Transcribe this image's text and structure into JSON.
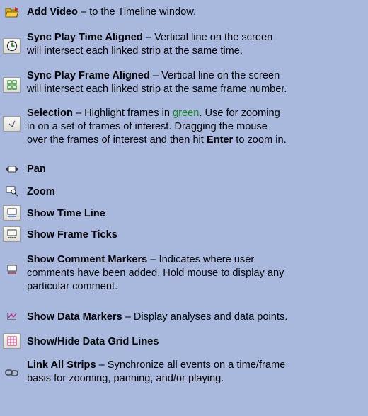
{
  "items": [
    {
      "icon": "folder-open-icon",
      "title": "Add Video",
      "desc": "– to the Timeline window."
    },
    {
      "icon": "clock-icon",
      "title": "Sync Play Time Aligned",
      "desc": "– Vertical line on the screen",
      "desc2": "will intersect each linked strip at the same time."
    },
    {
      "icon": "frame-grid-icon",
      "title": "Sync Play Frame Aligned",
      "desc": "– Vertical line on the screen",
      "desc2": "will intersect each linked strip at the same frame number."
    },
    {
      "icon": "selection-cursor-icon",
      "title": "Selection",
      "desc_pre": "– Highlight frames in ",
      "desc_green": "green",
      "desc_post": ". Use for zooming",
      "desc2": "in on a set of frames of interest. Dragging the mouse",
      "desc3_pre": "over the frames of interest and then hit ",
      "desc3_bold": "Enter",
      "desc3_post": " to zoom in."
    },
    {
      "icon": "pan-icon",
      "title": "Pan"
    },
    {
      "icon": "zoom-icon",
      "title": "Zoom"
    },
    {
      "icon": "time-line-icon",
      "title": "Show Time Line"
    },
    {
      "icon": "frame-ticks-icon",
      "title": "Show Frame Ticks"
    },
    {
      "icon": "comment-markers-icon",
      "title": "Show Comment Markers",
      "desc": "– Indicates where user",
      "desc2": "comments have been added. Hold mouse to display any",
      "desc3": "particular comment."
    },
    {
      "icon": "data-markers-icon",
      "title": "Show Data Markers",
      "desc": "– Display analyses and data points."
    },
    {
      "icon": "grid-lines-icon",
      "title": "Show/Hide Data Grid Lines"
    },
    {
      "icon": "link-strips-icon",
      "title": "Link All Strips",
      "desc": "– Synchronize all events on a  time/frame",
      "desc2": "basis for zooming, panning, and/or playing."
    }
  ]
}
